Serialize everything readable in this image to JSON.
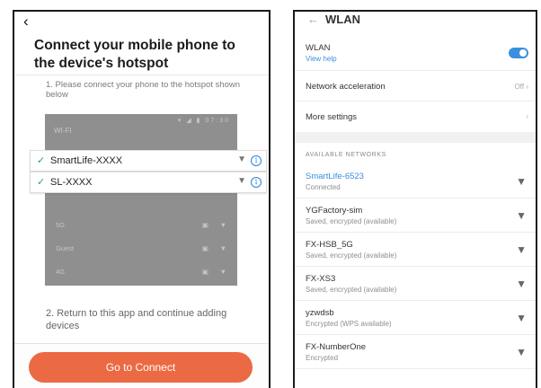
{
  "left_screen": {
    "back_icon": "back-arrow-icon",
    "title": "Connect your mobile phone to the device's hotspot",
    "step1": "1. Please connect your phone to the hotspot shown below",
    "illustration": {
      "status_icons": "▾ ◢ ▮ 07:30",
      "wifi_label": "WI-FI",
      "blurred_networks": [
        {
          "name": "5G"
        },
        {
          "name": "Guest"
        },
        {
          "name": "4G"
        }
      ]
    },
    "highlighted_networks": [
      {
        "name": "SmartLife-XXXX",
        "icon": "check-icon"
      },
      {
        "name": "SL-XXXX",
        "icon": "check-icon"
      }
    ],
    "step2": "2. Return to this app and continue adding devices",
    "button": "Go to Connect",
    "accent_color": "#eb6a43"
  },
  "right_screen": {
    "header": {
      "back_icon": "back-arrow-icon",
      "title": "WLAN"
    },
    "wlan": {
      "label": "WLAN",
      "help": "View help",
      "enabled": true
    },
    "network_acceleration": {
      "label": "Network acceleration",
      "value": "Off"
    },
    "more_settings": {
      "label": "More settings"
    },
    "section_title": "AVAILABLE NETWORKS",
    "networks": [
      {
        "name": "SmartLife-6523",
        "status": "Connected",
        "connected": true
      },
      {
        "name": "YGFactory-sim",
        "status": "Saved, encrypted (available)"
      },
      {
        "name": "FX-HSB_5G",
        "status": "Saved, encrypted (available)"
      },
      {
        "name": "FX-XS3",
        "status": "Saved, encrypted (available)"
      },
      {
        "name": "yzwdsb",
        "status": "Encrypted (WPS available)"
      },
      {
        "name": "FX-NumberOne",
        "status": "Encrypted"
      }
    ]
  }
}
